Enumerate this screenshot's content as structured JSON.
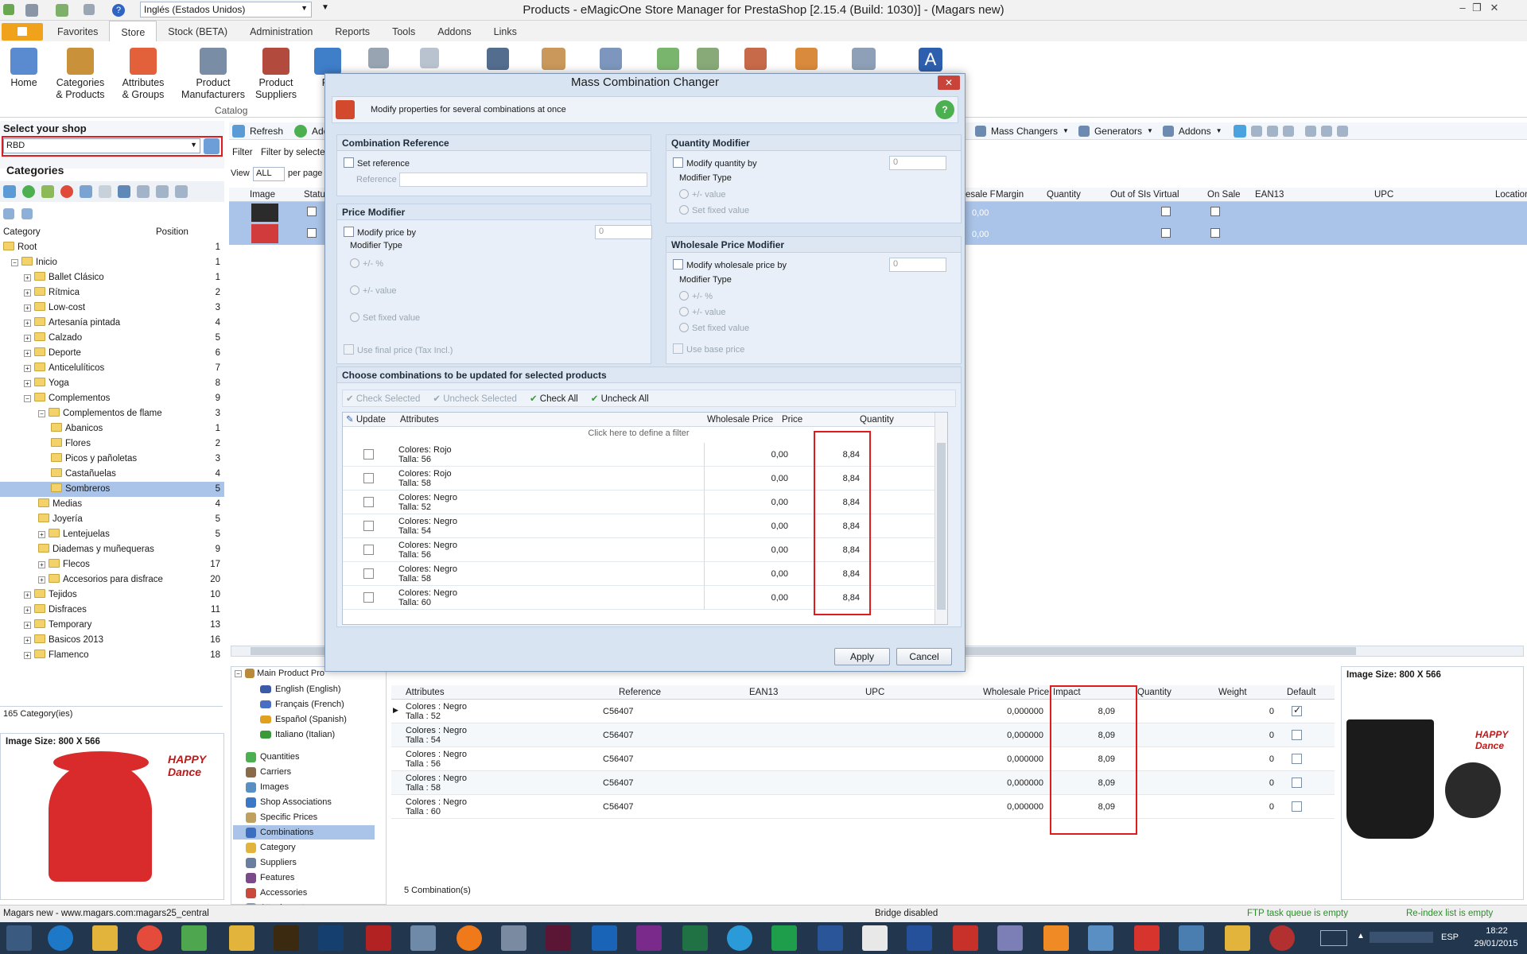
{
  "window": {
    "title": "Products - eMagicOne Store Manager for PrestaShop [2.15.4 (Build: 1030)] - (Magars new)",
    "language": "Inglés (Estados Unidos)"
  },
  "tabs": [
    "Favorites",
    "Store",
    "Stock (BETA)",
    "Administration",
    "Reports",
    "Tools",
    "Addons",
    "Links"
  ],
  "active_tab": "Store",
  "ribbon": {
    "home": "Home",
    "categories": "Categories & Products",
    "attributes": "Attributes & Groups",
    "manufacturers": "Product Manufacturers",
    "suppliers": "Product Suppliers",
    "features_short": "Fe",
    "group": "Catalog"
  },
  "shop": {
    "label": "Select your shop",
    "value": "RBD"
  },
  "categories": {
    "title": "Categories",
    "col_category": "Category",
    "col_position": "Position",
    "count": "165 Category(ies)",
    "items": [
      {
        "name": "Root",
        "pos": "1",
        "level": 0
      },
      {
        "name": "Inicio",
        "pos": "1",
        "level": 1
      },
      {
        "name": "Ballet Clásico",
        "pos": "1",
        "level": 2
      },
      {
        "name": "Rítmica",
        "pos": "2",
        "level": 2
      },
      {
        "name": "Low-cost",
        "pos": "3",
        "level": 2
      },
      {
        "name": "Artesanía pintada",
        "pos": "4",
        "level": 2
      },
      {
        "name": "Calzado",
        "pos": "5",
        "level": 2
      },
      {
        "name": "Deporte",
        "pos": "6",
        "level": 2
      },
      {
        "name": "Anticelulíticos",
        "pos": "7",
        "level": 2
      },
      {
        "name": "Yoga",
        "pos": "8",
        "level": 2
      },
      {
        "name": "Complementos",
        "pos": "9",
        "level": 2
      },
      {
        "name": "Complementos de flame",
        "pos": "3",
        "level": 3
      },
      {
        "name": "Abanicos",
        "pos": "1",
        "level": 4
      },
      {
        "name": "Flores",
        "pos": "2",
        "level": 4
      },
      {
        "name": "Picos y pañoletas",
        "pos": "3",
        "level": 4
      },
      {
        "name": "Castañuelas",
        "pos": "4",
        "level": 4
      },
      {
        "name": "Sombreros",
        "pos": "5",
        "level": 4
      },
      {
        "name": "Medias",
        "pos": "4",
        "level": 3
      },
      {
        "name": "Joyería",
        "pos": "5",
        "level": 3
      },
      {
        "name": "Lentejuelas",
        "pos": "5",
        "level": 3
      },
      {
        "name": "Diademas y muñequeras",
        "pos": "9",
        "level": 3
      },
      {
        "name": "Flecos",
        "pos": "17",
        "level": 3
      },
      {
        "name": "Accesorios para disfrace",
        "pos": "20",
        "level": 3
      },
      {
        "name": "Tejidos",
        "pos": "10",
        "level": 2
      },
      {
        "name": "Disfraces",
        "pos": "11",
        "level": 2
      },
      {
        "name": "Temporary",
        "pos": "13",
        "level": 2
      },
      {
        "name": "Basicos 2013",
        "pos": "16",
        "level": 2
      },
      {
        "name": "Flamenco",
        "pos": "18",
        "level": 2
      }
    ]
  },
  "image_size": "Image Size: 800 X 566",
  "logo_text": "HAPPY Dance",
  "toolbar": {
    "refresh": "Refresh",
    "add": "Add",
    "filter": "Filter",
    "filter_by": "Filter by selecte",
    "view": "View",
    "view_value": "ALL",
    "per_page": "per page",
    "mass_changers": "Mass Changers",
    "generators": "Generators",
    "addons": "Addons"
  },
  "product_grid_headers": [
    "Image",
    "Status",
    "esale F",
    "Margin",
    "Quantity",
    "Out of S",
    "Is Virtual",
    "On Sale",
    "EAN13",
    "UPC",
    "Location"
  ],
  "product_rows": [
    {
      "value": "0,00"
    },
    {
      "value": "0,00"
    }
  ],
  "dialog": {
    "title": "Mass Combination Changer",
    "subtitle": "Modify properties for several combinations at once",
    "combination_reference": {
      "header": "Combination Reference",
      "set_reference": "Set reference",
      "reference_label": "Reference"
    },
    "price_modifier": {
      "header": "Price Modifier",
      "modify": "Modify price by",
      "value": "0",
      "type_label": "Modifier Type",
      "opt1": "+/- %",
      "opt2": "+/- value",
      "opt3": "Set fixed value",
      "final": "Use final price (Tax Incl.)"
    },
    "quantity_modifier": {
      "header": "Quantity Modifier",
      "modify": "Modify quantity by",
      "value": "0",
      "type_label": "Modifier Type",
      "opt1": "+/- value",
      "opt2": "Set fixed value"
    },
    "wholesale_modifier": {
      "header": "Wholesale Price Modifier",
      "modify": "Modify wholesale price by",
      "value": "0",
      "type_label": "Modifier Type",
      "opt1": "+/- %",
      "opt2": "+/- value",
      "opt3": "Set fixed value",
      "base": "Use base price"
    },
    "choose_header": "Choose combinations to be updated for selected products",
    "check_selected": "Check Selected",
    "uncheck_selected": "Uncheck Selected",
    "check_all": "Check All",
    "uncheck_all": "Uncheck All",
    "grid_headers": {
      "update": "Update",
      "attributes": "Attributes",
      "wholesale": "Wholesale Price",
      "price": "Price",
      "quantity": "Quantity"
    },
    "filter_hint": "Click here to define a filter",
    "rows": [
      {
        "a1": "Colores: Rojo",
        "a2": "Talla: 56",
        "wholesale": "0,00",
        "price": "8,84"
      },
      {
        "a1": "Colores: Rojo",
        "a2": "Talla: 58",
        "wholesale": "0,00",
        "price": "8,84"
      },
      {
        "a1": "Colores: Negro",
        "a2": "Talla: 52",
        "wholesale": "0,00",
        "price": "8,84"
      },
      {
        "a1": "Colores: Negro",
        "a2": "Talla: 54",
        "wholesale": "0,00",
        "price": "8,84"
      },
      {
        "a1": "Colores: Negro",
        "a2": "Talla: 56",
        "wholesale": "0,00",
        "price": "8,84"
      },
      {
        "a1": "Colores: Negro",
        "a2": "Talla: 58",
        "wholesale": "0,00",
        "price": "8,84"
      },
      {
        "a1": "Colores: Negro",
        "a2": "Talla: 60",
        "wholesale": "0,00",
        "price": "8,84"
      }
    ],
    "apply": "Apply",
    "cancel": "Cancel"
  },
  "nav": {
    "main_product": "Main Product Pro",
    "langs": [
      "English (English)",
      "Français (French)",
      "Español (Spanish)",
      "Italiano (Italian)"
    ],
    "items": [
      "Quantities",
      "Carriers",
      "Images",
      "Shop Associations",
      "Specific Prices",
      "Combinations",
      "Category",
      "Suppliers",
      "Features",
      "Accessories",
      "Attachments"
    ],
    "selected": "Combinations"
  },
  "combo_grid": {
    "headers": [
      "Attributes",
      "Reference",
      "EAN13",
      "UPC",
      "Wholesale Price",
      "Impact",
      "Quantity",
      "Weight",
      "Default"
    ],
    "rows": [
      {
        "a1": "Colores : Negro",
        "a2": "Talla : 52",
        "ref": "C56407",
        "wholesale": "0,000000",
        "impact": "8,09",
        "weight": "0",
        "default": true
      },
      {
        "a1": "Colores : Negro",
        "a2": "Talla : 54",
        "ref": "C56407",
        "wholesale": "0,000000",
        "impact": "8,09",
        "weight": "0",
        "default": false
      },
      {
        "a1": "Colores : Negro",
        "a2": "Talla : 56",
        "ref": "C56407",
        "wholesale": "0,000000",
        "impact": "8,09",
        "weight": "0",
        "default": false
      },
      {
        "a1": "Colores : Negro",
        "a2": "Talla : 58",
        "ref": "C56407",
        "wholesale": "0,000000",
        "impact": "8,09",
        "weight": "0",
        "default": false
      },
      {
        "a1": "Colores : Negro",
        "a2": "Talla : 60",
        "ref": "C56407",
        "wholesale": "0,000000",
        "impact": "8,09",
        "weight": "0",
        "default": false
      }
    ],
    "count": "5 Combination(s)"
  },
  "status": {
    "left": "Magars new - www.magars.com:magars25_central",
    "bridge": "Bridge disabled",
    "ftp": "FTP task queue is empty",
    "reindex": "Re-index list is empty"
  },
  "taskbar": {
    "lang": "ESP",
    "time": "18:22",
    "date": "29/01/2015"
  },
  "colors": {
    "accent": "#f0a21a",
    "dialog_bg": "#d8e4f2",
    "highlight": "#e01b1b",
    "selection": "#a9c4e8"
  }
}
